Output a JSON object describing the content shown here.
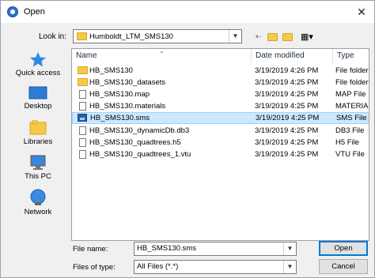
{
  "window": {
    "title": "Open",
    "close_glyph": "✕"
  },
  "toolbar": {
    "look_in_label": "Look in:",
    "look_in_value": "Humboldt_LTM_SMS130",
    "back_glyph": "🠠",
    "up_glyph": "⬑",
    "new_folder_glyph": "✨",
    "view_menu_glyph": "▦▾"
  },
  "places": [
    {
      "label": "Quick access",
      "icon": "star-icon"
    },
    {
      "label": "Desktop",
      "icon": "desktop-icon"
    },
    {
      "label": "Libraries",
      "icon": "libraries-icon"
    },
    {
      "label": "This PC",
      "icon": "computer-icon"
    },
    {
      "label": "Network",
      "icon": "network-icon"
    }
  ],
  "columns": {
    "name": "Name",
    "date": "Date modified",
    "type": "Type"
  },
  "files": [
    {
      "name": "HB_SMS130",
      "date": "3/19/2019 4:26 PM",
      "type": "File folder",
      "icon": "folder"
    },
    {
      "name": "HB_SMS130_datasets",
      "date": "3/19/2019 4:25 PM",
      "type": "File folder",
      "icon": "folder"
    },
    {
      "name": "HB_SMS130.map",
      "date": "3/19/2019 4:25 PM",
      "type": "MAP File",
      "icon": "doc"
    },
    {
      "name": "HB_SMS130.materials",
      "date": "3/19/2019 4:25 PM",
      "type": "MATERIAL",
      "icon": "doc"
    },
    {
      "name": "HB_SMS130.sms",
      "date": "3/19/2019 4:25 PM",
      "type": "SMS File",
      "icon": "sms"
    },
    {
      "name": "HB_SMS130_dynamicDb.db3",
      "date": "3/19/2019 4:25 PM",
      "type": "DB3 File",
      "icon": "doc"
    },
    {
      "name": "HB_SMS130_quadtrees.h5",
      "date": "3/19/2019 4:25 PM",
      "type": "H5 File",
      "icon": "doc"
    },
    {
      "name": "HB_SMS130_quadtrees_1.vtu",
      "date": "3/19/2019 4:25 PM",
      "type": "VTU File",
      "icon": "doc"
    }
  ],
  "footer": {
    "file_name_label": "File name:",
    "file_name_value": "HB_SMS130.sms",
    "file_type_label": "Files of type:",
    "file_type_value": "All Files (*.*)",
    "open_label": "Open",
    "cancel_label": "Cancel"
  },
  "colors": {
    "selection": "#cce8ff",
    "folder": "#f7c948",
    "accent": "#0078d7"
  }
}
